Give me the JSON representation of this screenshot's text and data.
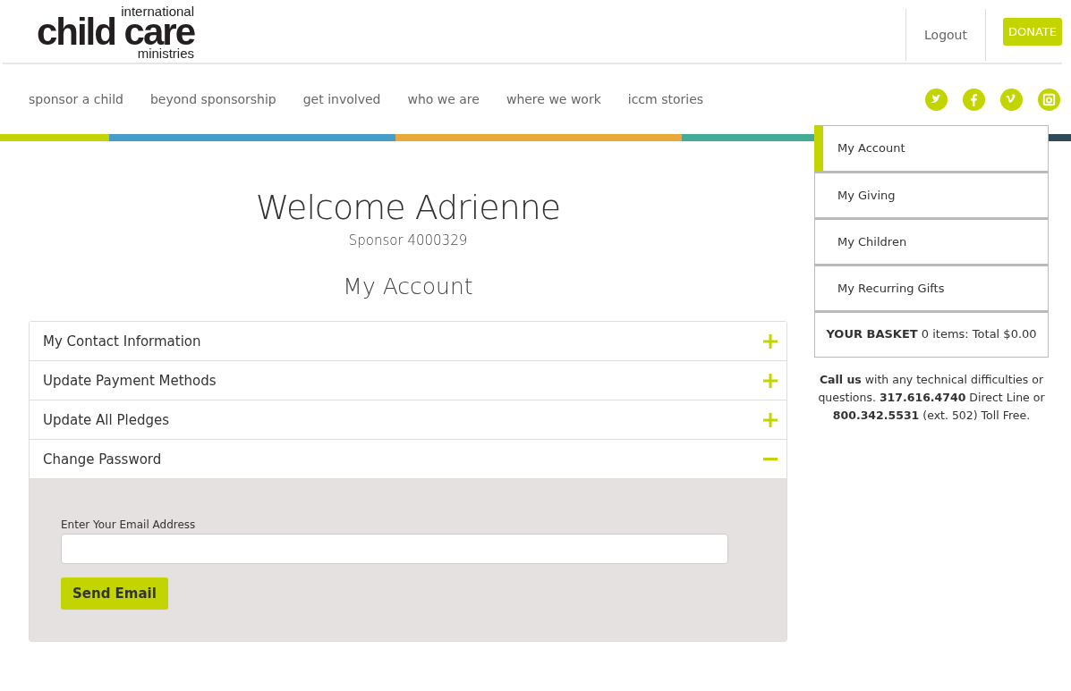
{
  "header": {
    "logo": {
      "top": "international",
      "wordmark": "child care",
      "bottom": "ministries"
    },
    "logout": "Logout",
    "donate": "DONATE"
  },
  "nav": {
    "items": [
      "sponsor a child",
      "beyond sponsorship",
      "get involved",
      "who we are",
      "where we work",
      "iccm stories"
    ]
  },
  "main": {
    "title": "Welcome Adrienne",
    "subtitle": "Sponsor 4000329",
    "heading": "My Account",
    "accordion": [
      {
        "label": "My Contact Information",
        "expanded": false
      },
      {
        "label": "Update Payment Methods",
        "expanded": false
      },
      {
        "label": "Update All Pledges",
        "expanded": false
      },
      {
        "label": "Change Password",
        "expanded": true,
        "field_label": "Enter Your Email Address",
        "button": "Send Email"
      }
    ]
  },
  "sidebar": {
    "items": [
      {
        "label": "My Account",
        "selected": true
      },
      {
        "label": "My Giving",
        "selected": false
      },
      {
        "label": "My Children",
        "selected": false
      },
      {
        "label": "My Recurring Gifts",
        "selected": false
      }
    ],
    "basket": "**YOUR BASKET** 0 items: Total $0.00",
    "contact": "**Call us** with any technical difficulties or questions. **317.616.4740** Direct Line or **800.342.5531** (ext. 502) Toll Free."
  }
}
